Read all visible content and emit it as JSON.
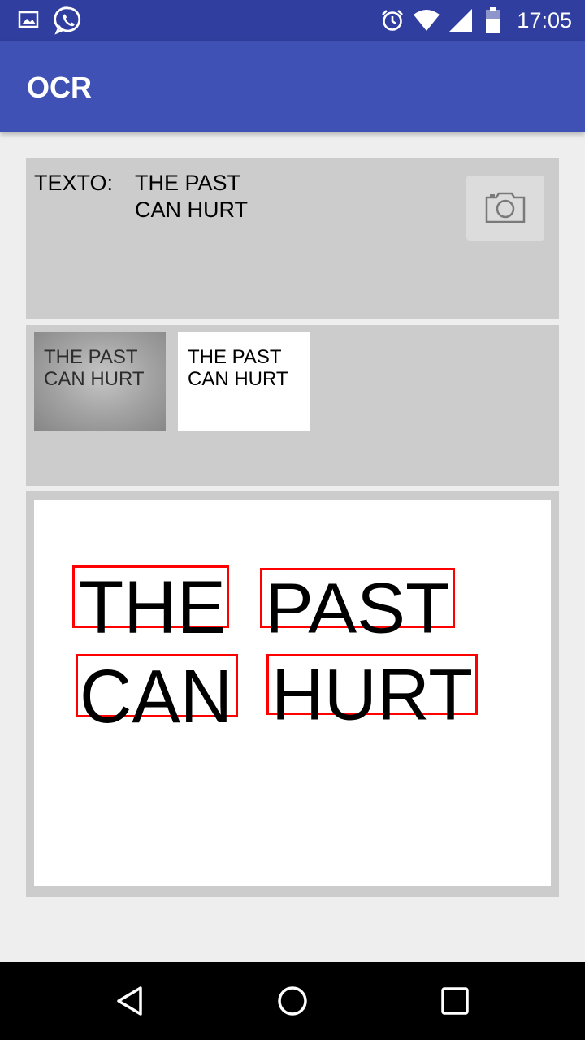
{
  "status_bar": {
    "time": "17:05",
    "icons": [
      "image-notification-icon",
      "whatsapp-icon",
      "alarm-icon",
      "wifi-icon",
      "signal-icon",
      "battery-icon"
    ]
  },
  "app_bar": {
    "title": "OCR"
  },
  "text_panel": {
    "label": "TEXTO:",
    "value": "THE PAST\nCAN HURT",
    "button_icon": "camera-icon"
  },
  "thumbnails": [
    {
      "name": "original-image",
      "text": "THE PAST\nCAN HURT"
    },
    {
      "name": "binarized-image",
      "text": "THE PAST\nCAN HURT"
    }
  ],
  "result_image": {
    "box_color": "#ff0000",
    "words": [
      "THE",
      "PAST",
      "CAN",
      "HURT"
    ]
  },
  "nav_bar": {
    "icons": [
      "back-icon",
      "home-icon",
      "recents-icon"
    ]
  }
}
